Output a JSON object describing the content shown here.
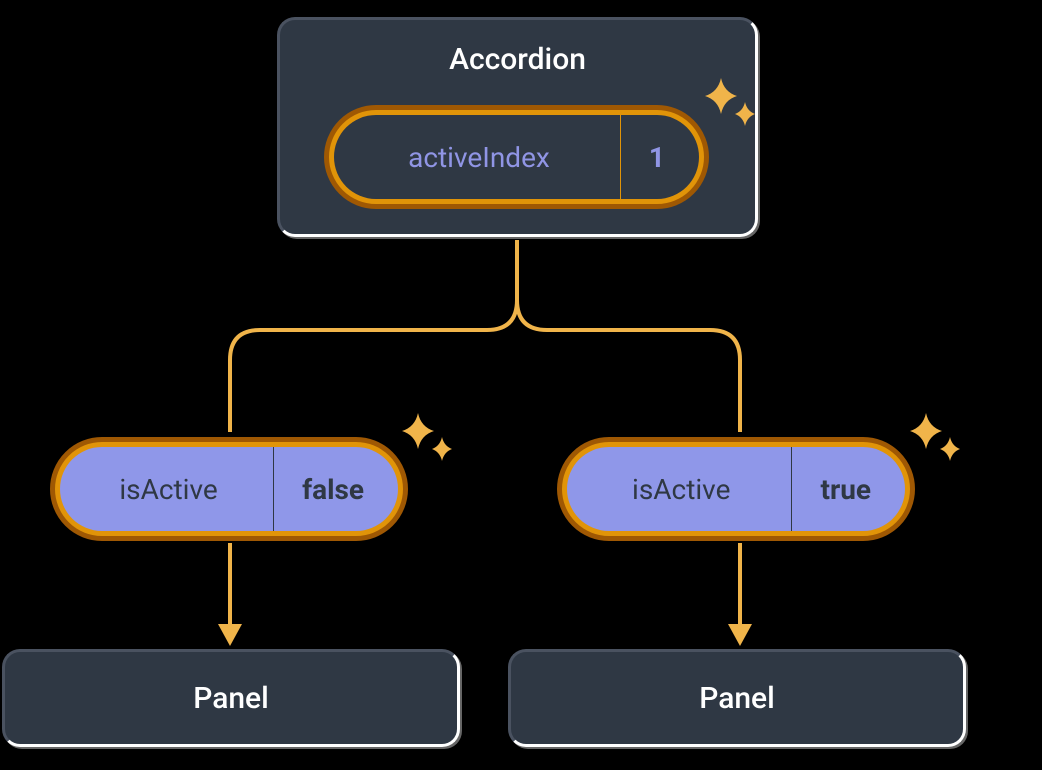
{
  "colors": {
    "background": "#000000",
    "box_fill": "#2f3844",
    "box_border": "#ffffff",
    "text_light": "#ffffff",
    "text_dark": "#2f3844",
    "accent_purple": "#8f97e9",
    "text_purple": "#9095e5",
    "pill_outer_border": "#9f5803",
    "pill_fill": "#e19408",
    "arrow": "#f0b44a",
    "sparkle": "#f0b44a"
  },
  "parent": {
    "title": "Accordion",
    "state_name": "activeIndex",
    "state_value": "1"
  },
  "children": [
    {
      "prop_name": "isActive",
      "prop_value": "false",
      "label": "Panel"
    },
    {
      "prop_name": "isActive",
      "prop_value": "true",
      "label": "Panel"
    }
  ]
}
